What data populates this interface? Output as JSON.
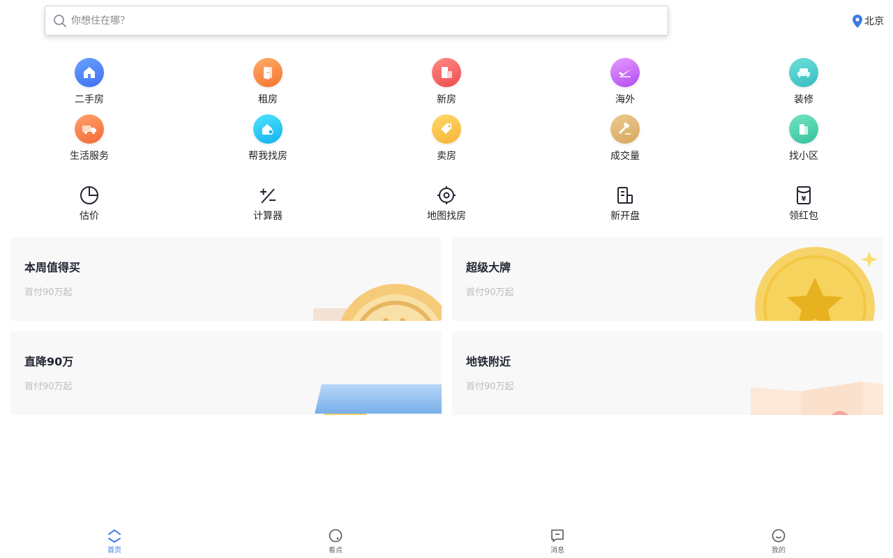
{
  "search": {
    "placeholder": "你想住在哪？",
    "icon": "search-icon"
  },
  "location": {
    "city": "北京",
    "icon": "location-pin-icon",
    "color": "#3c7be6"
  },
  "categories": [
    {
      "label": "二手房",
      "icon": "house-icon",
      "gradient": [
        "#6aa2ff",
        "#3e70f0"
      ]
    },
    {
      "label": "租房",
      "icon": "door-icon",
      "gradient": [
        "#ffac6a",
        "#f5742e"
      ]
    },
    {
      "label": "新房",
      "icon": "building-icon",
      "gradient": [
        "#ff8a85",
        "#ee4b4f"
      ]
    },
    {
      "label": "海外",
      "icon": "plane-icon",
      "gradient": [
        "#e79aff",
        "#b14cf0"
      ]
    },
    {
      "label": "装修",
      "icon": "sofa-icon",
      "gradient": [
        "#6fe0d9",
        "#36bcc0"
      ]
    },
    {
      "label": "生活服务",
      "icon": "truck-icon",
      "gradient": [
        "#ffa16c",
        "#f36a33"
      ]
    },
    {
      "label": "帮我找房",
      "icon": "house-search-icon",
      "gradient": [
        "#4fe3ff",
        "#12b2ee"
      ]
    },
    {
      "label": "卖房",
      "icon": "price-tag-icon",
      "gradient": [
        "#ffd76a",
        "#f6b436"
      ]
    },
    {
      "label": "成交量",
      "icon": "gavel-icon",
      "gradient": [
        "#ecc98e",
        "#d7a85e"
      ]
    },
    {
      "label": "找小区",
      "icon": "community-icon",
      "gradient": [
        "#74e4c2",
        "#34c29c"
      ]
    }
  ],
  "tools": [
    {
      "label": "估价",
      "icon": "pie-chart-icon"
    },
    {
      "label": "计算器",
      "icon": "calculator-icon"
    },
    {
      "label": "地图找房",
      "icon": "map-target-icon"
    },
    {
      "label": "新开盘",
      "icon": "new-building-icon"
    },
    {
      "label": "领红包",
      "icon": "red-envelope-icon"
    }
  ],
  "promos": [
    {
      "title": "本周值得买",
      "subtitle": "首付90万起",
      "art": "coin-art"
    },
    {
      "title": "超级大牌",
      "subtitle": "首付90万起",
      "art": "star-coin-art"
    },
    {
      "title": "直降90万",
      "subtitle": "首付90万起",
      "art": "blue-card-art"
    },
    {
      "title": "地铁附近",
      "subtitle": "首付90万起",
      "art": "map-art"
    }
  ],
  "bottom_nav": [
    {
      "label": "首页",
      "icon": "home-icon",
      "active": true
    },
    {
      "label": "看点",
      "icon": "discover-icon",
      "active": false
    },
    {
      "label": "消息",
      "icon": "message-icon",
      "active": false
    },
    {
      "label": "我的",
      "icon": "profile-icon",
      "active": false
    }
  ],
  "colors": {
    "accent": "#3c7be6",
    "text": "#1f2430",
    "muted": "#bcbcbc",
    "card_bg": "#f8f8f8"
  }
}
